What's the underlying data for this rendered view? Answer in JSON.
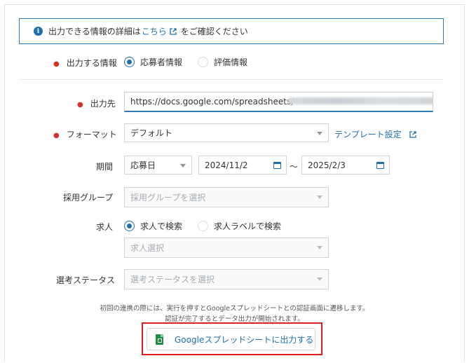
{
  "info": {
    "text_before": "出力できる情報の詳細は",
    "link": "こちら",
    "text_after": "をご確認ください"
  },
  "output_info": {
    "label": "出力する情報",
    "options": [
      "応募者情報",
      "評価情報"
    ],
    "selected": "応募者情報"
  },
  "destination": {
    "label": "出力先",
    "value": "https://docs.google.com/spreadsheets/"
  },
  "format": {
    "label": "フォーマット",
    "value": "デフォルト",
    "template_link": "テンプレート設定"
  },
  "period": {
    "label": "期間",
    "type_value": "応募日",
    "start_date": "2024/11/2",
    "separator": "～",
    "end_date": "2025/2/3"
  },
  "group": {
    "label": "採用グループ",
    "placeholder": "採用グループを選択"
  },
  "job": {
    "label": "求人",
    "options": [
      "求人で検索",
      "求人ラベルで検索"
    ],
    "selected": "求人で検索",
    "placeholder": "求人選択"
  },
  "status": {
    "label": "選考ステータス",
    "placeholder": "選考ステータスを選択"
  },
  "notes": {
    "line1": "初回の連携の際には、実行を押すとGoogleスプレッドシートとの認証画面に遷移します。",
    "line2": "認証が完了するとデータ出力が開始されます。"
  },
  "export_button": {
    "label": "Googleスプレッドシートに出力する"
  },
  "colors": {
    "primary": "#1e6fb0",
    "required": "#d9302c",
    "highlight": "#e0201f",
    "sheets_green": "#1e8e3e"
  }
}
